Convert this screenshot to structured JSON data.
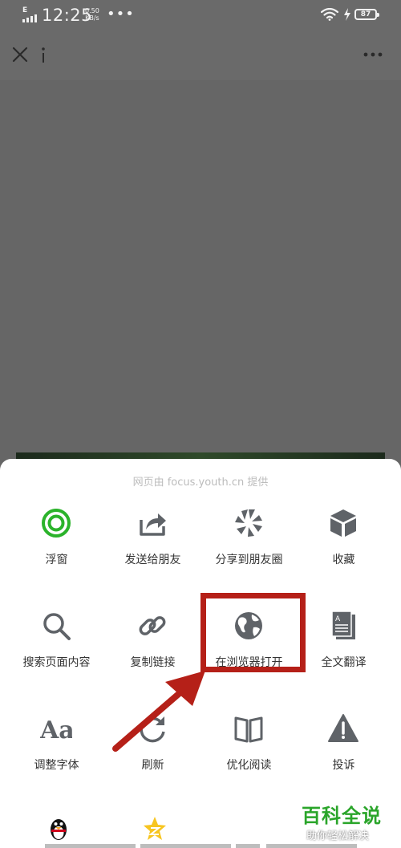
{
  "status_bar": {
    "network_type": "E",
    "time": "12:25",
    "speed_value": "0.50",
    "speed_unit": "KB/s",
    "overflow": "•••",
    "battery": "87"
  },
  "nav": {
    "close_icon": "close-icon",
    "info_icon": "info-icon",
    "more_icon": "more-icon"
  },
  "sheet": {
    "caption": "网页由 focus.youth.cn 提供",
    "actions": [
      {
        "label": "浮窗",
        "icon": "float-window-icon"
      },
      {
        "label": "发送给朋友",
        "icon": "share-icon"
      },
      {
        "label": "分享到朋友圈",
        "icon": "moments-icon"
      },
      {
        "label": "收藏",
        "icon": "favorite-cube-icon"
      },
      {
        "label": "搜索页面内容",
        "icon": "search-icon"
      },
      {
        "label": "复制链接",
        "icon": "link-icon"
      },
      {
        "label": "在浏览器打开",
        "icon": "globe-icon"
      },
      {
        "label": "全文翻译",
        "icon": "translate-icon"
      },
      {
        "label": "调整字体",
        "icon": "font-icon"
      },
      {
        "label": "刷新",
        "icon": "refresh-icon"
      },
      {
        "label": "优化阅读",
        "icon": "book-icon"
      },
      {
        "label": "投诉",
        "icon": "warning-icon"
      }
    ]
  },
  "colors": {
    "accent_green": "#2bb32b",
    "icon_gray": "#5f6368",
    "highlight_red": "#b52018"
  },
  "watermark": {
    "title": "百科全说",
    "subtitle": "助你轻松解决"
  }
}
